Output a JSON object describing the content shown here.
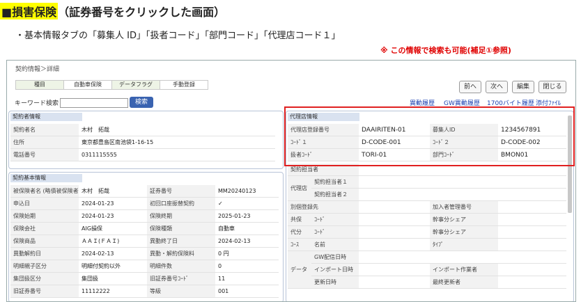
{
  "header": {
    "marker": "■",
    "title_highlight": "損害保険",
    "title_rest": "（証券番号をクリックした画面）",
    "subtitle": "・基本情報タブの「募集人 ID」「扱者コード」「部門コード」「代理店コード１」",
    "note": "※ この情報で検索も可能(補足①参照)"
  },
  "app": {
    "breadcrumb": "契約情報＞詳細",
    "tabs": [
      {
        "label": "種目",
        "active": true
      },
      {
        "label": "自動車保険",
        "active": false
      },
      {
        "label": "データフラグ",
        "active": true
      },
      {
        "label": "手動登録",
        "active": false
      }
    ],
    "keyword_label": "キーワード検索",
    "keyword_value": "",
    "search_button": "検索",
    "nav_buttons": {
      "prev": "前へ",
      "next": "次へ",
      "edit": "編集",
      "close": "閉じる"
    },
    "links": {
      "history": "異動履歴",
      "gw_history": "GW異動履歴",
      "byte_history": "1700バイト履歴",
      "attachments": "添付ﾌｧｲﾙ"
    }
  },
  "contractor": {
    "heading": "契約者情報",
    "rows": [
      {
        "label": "契約者名",
        "value": "木村　拓哉"
      },
      {
        "label": "住所",
        "value": "東京都豊島区南池袋1-16-15"
      },
      {
        "label": "電話番号",
        "value": "0311115555"
      }
    ]
  },
  "basic": {
    "heading": "契約基本情報",
    "rows": [
      {
        "l1": "被保険者名 (略債被保険者)",
        "v1": "木村　拓哉",
        "l2": "証券番号",
        "v2": "MM20240123"
      },
      {
        "l1": "申込日",
        "v1": "2024-01-23",
        "l2": "初回口座振替契約",
        "v2": "✓"
      },
      {
        "l1": "保険始期",
        "v1": "2024-01-23",
        "l2": "保険終期",
        "v2": "2025-01-23"
      },
      {
        "l1": "保険会社",
        "v1": "AIG損保",
        "l2": "保険種類",
        "v2": "自動車"
      },
      {
        "l1": "保険商品",
        "v1": "ＡＡＩ(ＦＡＩ)",
        "l2": "異動終了日",
        "v2": "2024-02-13"
      },
      {
        "l1": "異動解約日",
        "v1": "2024-02-13",
        "l2": "異動・解約保険料",
        "v2": "0 円"
      },
      {
        "l1": "明細親子区分",
        "v1": "明細付契約以外",
        "l2": "明細件数",
        "v2": "0"
      },
      {
        "l1": "集団扱区分",
        "v1": "集団扱",
        "l2": "旧証券番号ｺｰﾄﾞ",
        "v2": "11"
      },
      {
        "l1": "旧証券番号",
        "v1": "11112222",
        "l2": "等級",
        "v2": "001"
      }
    ]
  },
  "agency": {
    "heading": "代理店情報",
    "rows": [
      {
        "l1": "代理店登録番号",
        "v1": "DAAIRITEN-01",
        "l2": "募集人ID",
        "v2": "1234567891"
      },
      {
        "l1": "ｺｰﾄﾞ１",
        "v1": "D-CODE-001",
        "l2": "ｺｰﾄﾞ２",
        "v2": "D-CODE-002"
      },
      {
        "l1": "扱者ｺｰﾄﾞ",
        "v1": "TORI-01",
        "l2": "部門ｺｰﾄﾞ",
        "v2": "BMON01"
      }
    ],
    "lower": {
      "person": "契約担当者",
      "agency": "代理店",
      "person1": "契約担当者１",
      "person2": "契約担当者２",
      "other": "別個登録先",
      "member_no": "加入者管理番号",
      "co": "共保",
      "co_code": "ｺｰﾄﾞ",
      "co_share": "幹事分シェア",
      "sub": "代分",
      "sub_code": "ｺｰﾄﾞ",
      "sub_share": "幹事分シェア",
      "course": "ｺｰｽ",
      "course_name": "名前",
      "type": "ﾀｲﾌﾟ",
      "data": "データ",
      "gw_date": "GW配信日時",
      "import_date": "インポート日時",
      "import_user": "インポート作業者",
      "updated": "更新日時",
      "last_updater": "最終更新者"
    }
  },
  "colors": {
    "accent": "#3a63b0",
    "highlight": "#ffff00",
    "alert": "#e00000",
    "panel_head": "#d9e2f0"
  }
}
